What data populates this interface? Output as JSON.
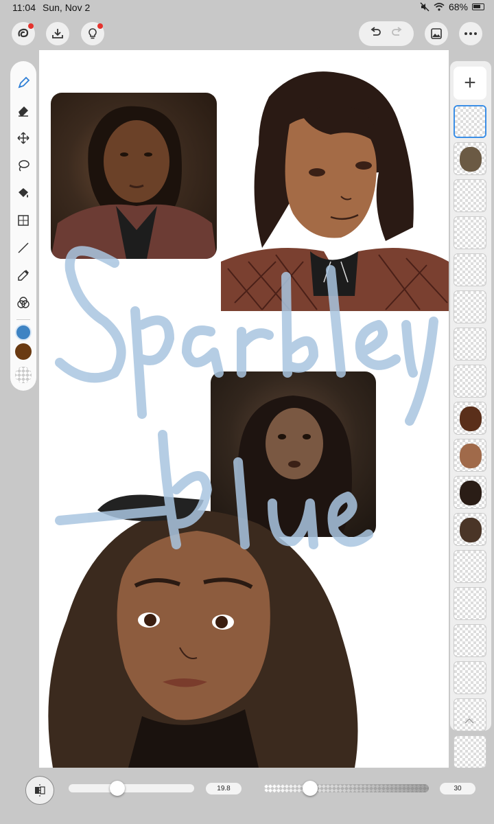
{
  "status_bar": {
    "time": "11:04",
    "date": "Sun, Nov 2",
    "battery": "68%"
  },
  "toolbar": {
    "left_icons": [
      "app-menu-icon",
      "import-icon",
      "tips-icon"
    ],
    "undo_icon": "undo-icon",
    "redo_icon": "redo-icon",
    "right_icons": [
      "gallery-icon",
      "more-icon"
    ]
  },
  "tools": [
    "brush-icon",
    "eraser-icon",
    "move-icon",
    "lasso-icon",
    "fill-icon",
    "transform-icon",
    "line-icon",
    "eyedropper-icon",
    "blend-icon"
  ],
  "colors": {
    "primary": "#3e83c3",
    "secondary": "#6a3a12",
    "accent": "#3a8ee6",
    "watermark": "#a9c5e0"
  },
  "layers": {
    "add_label": "+",
    "count": 18
  },
  "bottom": {
    "brush_size": "19.8",
    "brush_size_fraction": 0.39,
    "opacity": "30",
    "opacity_fraction": 0.28
  }
}
